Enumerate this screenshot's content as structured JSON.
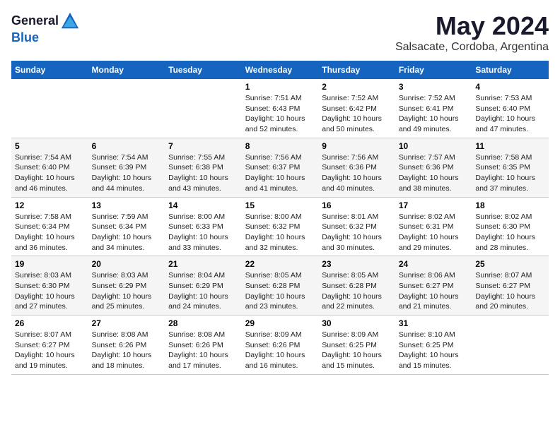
{
  "header": {
    "logo": {
      "line1": "General",
      "line2": "Blue"
    },
    "title": "May 2024",
    "subtitle": "Salsacate, Cordoba, Argentina"
  },
  "calendar": {
    "weekdays": [
      "Sunday",
      "Monday",
      "Tuesday",
      "Wednesday",
      "Thursday",
      "Friday",
      "Saturday"
    ],
    "weeks": [
      [
        {
          "day": "",
          "info": ""
        },
        {
          "day": "",
          "info": ""
        },
        {
          "day": "",
          "info": ""
        },
        {
          "day": "1",
          "info": "Sunrise: 7:51 AM\nSunset: 6:43 PM\nDaylight: 10 hours\nand 52 minutes."
        },
        {
          "day": "2",
          "info": "Sunrise: 7:52 AM\nSunset: 6:42 PM\nDaylight: 10 hours\nand 50 minutes."
        },
        {
          "day": "3",
          "info": "Sunrise: 7:52 AM\nSunset: 6:41 PM\nDaylight: 10 hours\nand 49 minutes."
        },
        {
          "day": "4",
          "info": "Sunrise: 7:53 AM\nSunset: 6:40 PM\nDaylight: 10 hours\nand 47 minutes."
        }
      ],
      [
        {
          "day": "5",
          "info": "Sunrise: 7:54 AM\nSunset: 6:40 PM\nDaylight: 10 hours\nand 46 minutes."
        },
        {
          "day": "6",
          "info": "Sunrise: 7:54 AM\nSunset: 6:39 PM\nDaylight: 10 hours\nand 44 minutes."
        },
        {
          "day": "7",
          "info": "Sunrise: 7:55 AM\nSunset: 6:38 PM\nDaylight: 10 hours\nand 43 minutes."
        },
        {
          "day": "8",
          "info": "Sunrise: 7:56 AM\nSunset: 6:37 PM\nDaylight: 10 hours\nand 41 minutes."
        },
        {
          "day": "9",
          "info": "Sunrise: 7:56 AM\nSunset: 6:36 PM\nDaylight: 10 hours\nand 40 minutes."
        },
        {
          "day": "10",
          "info": "Sunrise: 7:57 AM\nSunset: 6:36 PM\nDaylight: 10 hours\nand 38 minutes."
        },
        {
          "day": "11",
          "info": "Sunrise: 7:58 AM\nSunset: 6:35 PM\nDaylight: 10 hours\nand 37 minutes."
        }
      ],
      [
        {
          "day": "12",
          "info": "Sunrise: 7:58 AM\nSunset: 6:34 PM\nDaylight: 10 hours\nand 36 minutes."
        },
        {
          "day": "13",
          "info": "Sunrise: 7:59 AM\nSunset: 6:34 PM\nDaylight: 10 hours\nand 34 minutes."
        },
        {
          "day": "14",
          "info": "Sunrise: 8:00 AM\nSunset: 6:33 PM\nDaylight: 10 hours\nand 33 minutes."
        },
        {
          "day": "15",
          "info": "Sunrise: 8:00 AM\nSunset: 6:32 PM\nDaylight: 10 hours\nand 32 minutes."
        },
        {
          "day": "16",
          "info": "Sunrise: 8:01 AM\nSunset: 6:32 PM\nDaylight: 10 hours\nand 30 minutes."
        },
        {
          "day": "17",
          "info": "Sunrise: 8:02 AM\nSunset: 6:31 PM\nDaylight: 10 hours\nand 29 minutes."
        },
        {
          "day": "18",
          "info": "Sunrise: 8:02 AM\nSunset: 6:30 PM\nDaylight: 10 hours\nand 28 minutes."
        }
      ],
      [
        {
          "day": "19",
          "info": "Sunrise: 8:03 AM\nSunset: 6:30 PM\nDaylight: 10 hours\nand 27 minutes."
        },
        {
          "day": "20",
          "info": "Sunrise: 8:03 AM\nSunset: 6:29 PM\nDaylight: 10 hours\nand 25 minutes."
        },
        {
          "day": "21",
          "info": "Sunrise: 8:04 AM\nSunset: 6:29 PM\nDaylight: 10 hours\nand 24 minutes."
        },
        {
          "day": "22",
          "info": "Sunrise: 8:05 AM\nSunset: 6:28 PM\nDaylight: 10 hours\nand 23 minutes."
        },
        {
          "day": "23",
          "info": "Sunrise: 8:05 AM\nSunset: 6:28 PM\nDaylight: 10 hours\nand 22 minutes."
        },
        {
          "day": "24",
          "info": "Sunrise: 8:06 AM\nSunset: 6:27 PM\nDaylight: 10 hours\nand 21 minutes."
        },
        {
          "day": "25",
          "info": "Sunrise: 8:07 AM\nSunset: 6:27 PM\nDaylight: 10 hours\nand 20 minutes."
        }
      ],
      [
        {
          "day": "26",
          "info": "Sunrise: 8:07 AM\nSunset: 6:27 PM\nDaylight: 10 hours\nand 19 minutes."
        },
        {
          "day": "27",
          "info": "Sunrise: 8:08 AM\nSunset: 6:26 PM\nDaylight: 10 hours\nand 18 minutes."
        },
        {
          "day": "28",
          "info": "Sunrise: 8:08 AM\nSunset: 6:26 PM\nDaylight: 10 hours\nand 17 minutes."
        },
        {
          "day": "29",
          "info": "Sunrise: 8:09 AM\nSunset: 6:26 PM\nDaylight: 10 hours\nand 16 minutes."
        },
        {
          "day": "30",
          "info": "Sunrise: 8:09 AM\nSunset: 6:25 PM\nDaylight: 10 hours\nand 15 minutes."
        },
        {
          "day": "31",
          "info": "Sunrise: 8:10 AM\nSunset: 6:25 PM\nDaylight: 10 hours\nand 15 minutes."
        },
        {
          "day": "",
          "info": ""
        }
      ]
    ]
  }
}
